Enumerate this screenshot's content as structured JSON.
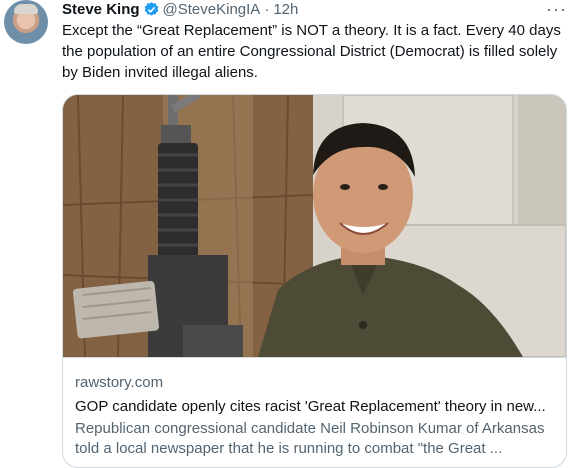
{
  "author": {
    "name": "Steve King",
    "handle": "@SteveKingIA",
    "separator": "·",
    "time": "12h",
    "more": "···"
  },
  "tweet": {
    "text": "Except the “Great Replacement” is NOT a theory. It is a fact. Every 40 days the population of an entire Congressional District (Democrat) is filled solely by Biden invited illegal aliens."
  },
  "card": {
    "domain": "rawstory.com",
    "title": "GOP candidate openly cites racist 'Great Replacement' theory in new...",
    "description": "Republican congressional candidate Neil Robinson Kumar of Arkansas told a local newspaper that he is running to combat \"the Great ..."
  },
  "colors": {
    "verified": "#1d9bf0",
    "secondary_text": "#536471",
    "border": "#cfd9de"
  }
}
